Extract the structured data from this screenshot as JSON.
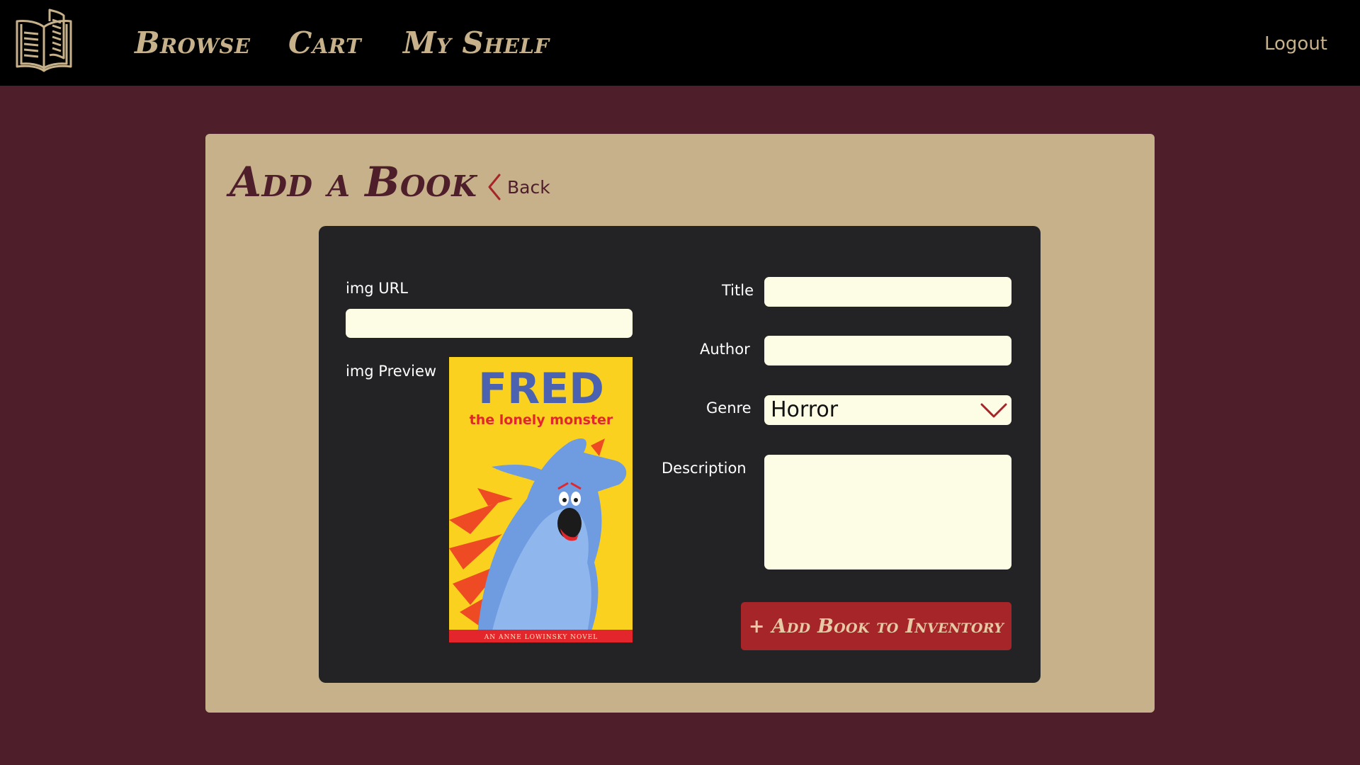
{
  "nav": {
    "links": [
      "Browse",
      "Cart",
      "My Shelf"
    ],
    "logout": "Logout",
    "logo_icon": "open-book-icon"
  },
  "page": {
    "title": "Add a Book",
    "back_label": "Back"
  },
  "form": {
    "img_url_label": "img URL",
    "img_url_value": "",
    "img_preview_label": "img Preview",
    "title_label": "Title",
    "title_value": "",
    "author_label": "Author",
    "author_value": "",
    "genre_label": "Genre",
    "genre_value": "Horror",
    "description_label": "Description",
    "description_value": "",
    "submit_label": "+ Add Book to Inventory"
  },
  "cover": {
    "title": "FRED",
    "subtitle": "the lonely monster",
    "footer": "AN ANNE LOWINSKY NOVEL"
  },
  "colors": {
    "background": "#4f1e2b",
    "nav": "#000000",
    "panel": "#c6b18b",
    "card": "#232325",
    "field": "#fdfde6",
    "accent": "#a52528",
    "cover_yellow": "#fbd11f"
  }
}
